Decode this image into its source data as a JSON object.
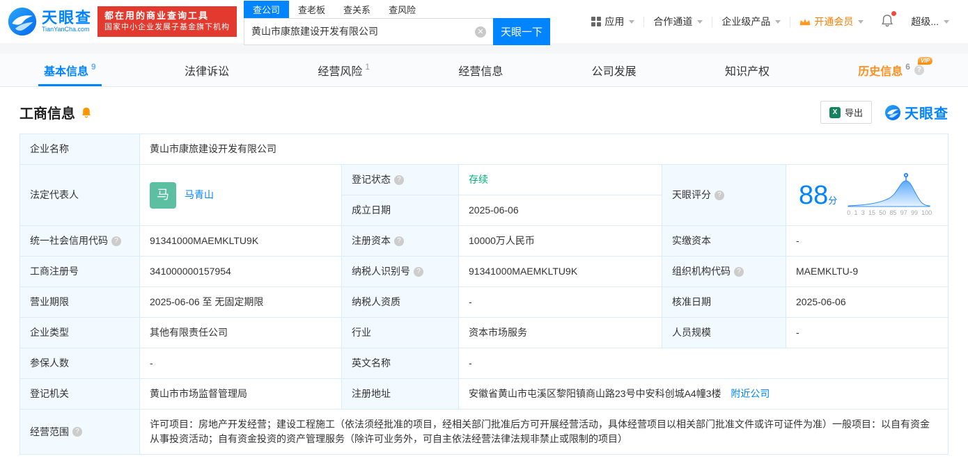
{
  "brand": {
    "logo_text": "天眼查",
    "logo_domain": "TianYanCha.com",
    "badge_line1": "都在用的商业查询工具",
    "badge_line2": "国家中小企业发展子基金旗下机构",
    "watermark": "天眼查"
  },
  "search": {
    "tabs": [
      {
        "label": "查公司"
      },
      {
        "label": "查老板"
      },
      {
        "label": "查关系"
      },
      {
        "label": "查风险"
      }
    ],
    "value": "黄山市康旅建设开发有限公司",
    "button": "天眼一下"
  },
  "top_nav": {
    "apps": "应用",
    "partner": "合作通道",
    "enterprise": "企业级产品",
    "vip": "开通会员",
    "account": "超级..."
  },
  "page_tabs": [
    {
      "label": "基本信息",
      "count": "9"
    },
    {
      "label": "法律诉讼",
      "count": ""
    },
    {
      "label": "经营风险",
      "count": "1"
    },
    {
      "label": "经营信息",
      "count": ""
    },
    {
      "label": "公司发展",
      "count": ""
    },
    {
      "label": "知识产权",
      "count": ""
    },
    {
      "label": "历史信息",
      "count": "6",
      "vip": "VIP"
    }
  ],
  "section": {
    "title": "工商信息",
    "export_label": "导出"
  },
  "info": {
    "company_name": {
      "label": "企业名称",
      "value": "黄山市康旅建设开发有限公司"
    },
    "legal_rep": {
      "label": "法定代表人",
      "avatar": "马",
      "name": "马青山"
    },
    "reg_status": {
      "label": "登记状态",
      "value": "存续"
    },
    "establish_date": {
      "label": "成立日期",
      "value": "2025-06-06"
    },
    "score": {
      "label": "天眼评分",
      "value": "88",
      "unit": "分"
    },
    "credit_code": {
      "label": "统一社会信用代码",
      "value": "91341000MAEMKLTU9K"
    },
    "reg_capital": {
      "label": "注册资本",
      "value": "10000万人民币"
    },
    "paid_capital": {
      "label": "实缴资本",
      "value": "-"
    },
    "reg_number": {
      "label": "工商注册号",
      "value": "341000000157954"
    },
    "taxpayer_id": {
      "label": "纳税人识别号",
      "value": "91341000MAEMKLTU9K"
    },
    "org_code": {
      "label": "组织机构代码",
      "value": "MAEMKLTU-9"
    },
    "business_term": {
      "label": "营业期限",
      "value": "2025-06-06 至 无固定期限"
    },
    "taxpayer_qualification": {
      "label": "纳税人资质",
      "value": "-"
    },
    "approval_date": {
      "label": "核准日期",
      "value": "2025-06-06"
    },
    "company_type": {
      "label": "企业类型",
      "value": "其他有限责任公司"
    },
    "industry": {
      "label": "行业",
      "value": "资本市场服务"
    },
    "staff_size": {
      "label": "人员规模",
      "value": "-"
    },
    "insured_count": {
      "label": "参保人数",
      "value": "-"
    },
    "english_name": {
      "label": "英文名称",
      "value": "-"
    },
    "registry_authority": {
      "label": "登记机关",
      "value": "黄山市市场监督管理局"
    },
    "reg_address": {
      "label": "注册地址",
      "value": "安徽省黄山市屯溪区黎阳镇商山路23号中安科创城A4幢3楼",
      "nearby_link": "附近公司"
    },
    "business_scope": {
      "label": "经营范围",
      "value": "许可项目：房地产开发经营；建设工程施工（依法须经批准的项目，经相关部门批准后方可开展经营活动，具体经营项目以相关部门批准文件或许可证件为准）一般项目：以自有资金从事投资活动；自有资金投资的资产管理服务（除许可业务外，可自主依法经营法律法规非禁止或限制的项目）"
    }
  },
  "score_chart": {
    "ticks": [
      "0",
      "1",
      "3",
      "15",
      "50",
      "85",
      "97",
      "99",
      "100"
    ]
  },
  "colors": {
    "brand_blue": "#0084ff",
    "status_green": "#00b277",
    "vip_orange": "#ff8f1f",
    "badge_red": "#e23a2e"
  }
}
